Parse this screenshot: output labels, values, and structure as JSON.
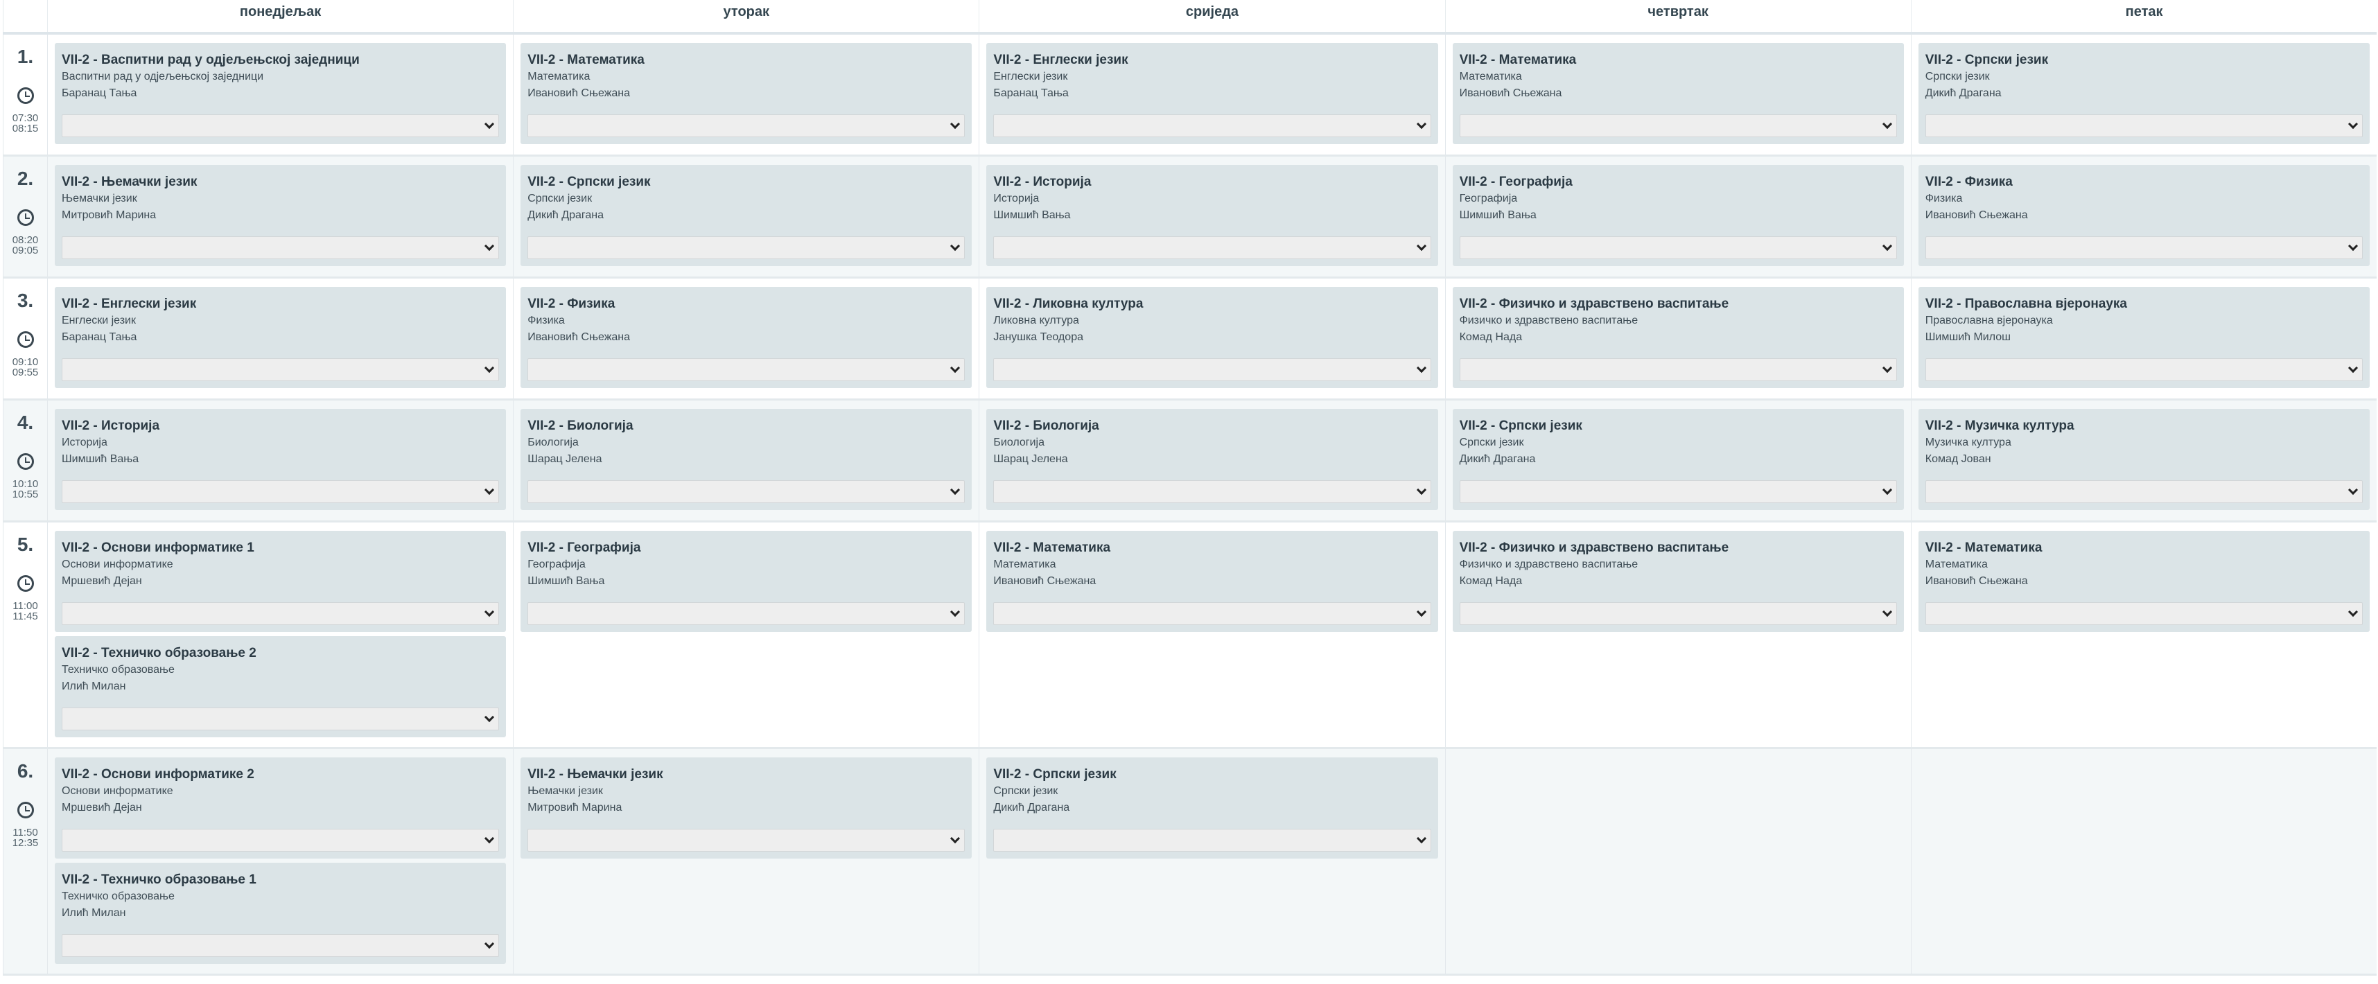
{
  "days": [
    "понедјељак",
    "уторак",
    "сриједа",
    "четвртак",
    "петак"
  ],
  "periods": [
    {
      "no": "1.",
      "start": "07:30",
      "end": "08:15",
      "cells": [
        [
          {
            "title": "VII-2 - Васпитни рад у одјељењској заједници",
            "subject": "Васпитни рад у одјељењској заједници",
            "teacher": "Баранац Тања"
          }
        ],
        [
          {
            "title": "VII-2 - Математика",
            "subject": "Математика",
            "teacher": "Ивановић Сњежана"
          }
        ],
        [
          {
            "title": "VII-2 - Енглески језик",
            "subject": "Енглески језик",
            "teacher": "Баранац Тања"
          }
        ],
        [
          {
            "title": "VII-2 - Математика",
            "subject": "Математика",
            "teacher": "Ивановић Сњежана"
          }
        ],
        [
          {
            "title": "VII-2 - Српски језик",
            "subject": "Српски језик",
            "teacher": "Дикић Драгана"
          }
        ]
      ]
    },
    {
      "no": "2.",
      "start": "08:20",
      "end": "09:05",
      "cells": [
        [
          {
            "title": "VII-2 - Њемачки језик",
            "subject": "Њемачки језик",
            "teacher": "Митровић Марина"
          }
        ],
        [
          {
            "title": "VII-2 - Српски језик",
            "subject": "Српски језик",
            "teacher": "Дикић Драгана"
          }
        ],
        [
          {
            "title": "VII-2 - Историја",
            "subject": "Историја",
            "teacher": "Шимшић Вања"
          }
        ],
        [
          {
            "title": "VII-2 - Географија",
            "subject": "Географија",
            "teacher": "Шимшић Вања"
          }
        ],
        [
          {
            "title": "VII-2 - Физика",
            "subject": "Физика",
            "teacher": "Ивановић Сњежана"
          }
        ]
      ]
    },
    {
      "no": "3.",
      "start": "09:10",
      "end": "09:55",
      "cells": [
        [
          {
            "title": "VII-2 - Енглески језик",
            "subject": "Енглески језик",
            "teacher": "Баранац Тања"
          }
        ],
        [
          {
            "title": "VII-2 - Физика",
            "subject": "Физика",
            "teacher": "Ивановић Сњежана"
          }
        ],
        [
          {
            "title": "VII-2 - Ликовна култура",
            "subject": "Ликовна култура",
            "teacher": "Јанушка Теодора"
          }
        ],
        [
          {
            "title": "VII-2 - Физичко и здравствено васпитање",
            "subject": "Физичко и здравствено васпитање",
            "teacher": "Комад Нада"
          }
        ],
        [
          {
            "title": "VII-2 - Православна вјеронаука",
            "subject": "Православна вјеронаука",
            "teacher": "Шимшић Милош"
          }
        ]
      ]
    },
    {
      "no": "4.",
      "start": "10:10",
      "end": "10:55",
      "cells": [
        [
          {
            "title": "VII-2 - Историја",
            "subject": "Историја",
            "teacher": "Шимшић Вања"
          }
        ],
        [
          {
            "title": "VII-2 - Биологија",
            "subject": "Биологија",
            "teacher": "Шарац Јелена"
          }
        ],
        [
          {
            "title": "VII-2 - Биологија",
            "subject": "Биологија",
            "teacher": "Шарац Јелена"
          }
        ],
        [
          {
            "title": "VII-2 - Српски језик",
            "subject": "Српски језик",
            "teacher": "Дикић Драгана"
          }
        ],
        [
          {
            "title": "VII-2 - Музичка култура",
            "subject": "Музичка култура",
            "teacher": "Комад Јован"
          }
        ]
      ]
    },
    {
      "no": "5.",
      "start": "11:00",
      "end": "11:45",
      "cells": [
        [
          {
            "title": "VII-2 - Основи информатике 1",
            "subject": "Основи информатике",
            "teacher": "Мршевић Дејан"
          },
          {
            "title": "VII-2 - Техничко образовање 2",
            "subject": "Техничко образовање",
            "teacher": "Илић Милан"
          }
        ],
        [
          {
            "title": "VII-2 - Географија",
            "subject": "Географија",
            "teacher": "Шимшић Вања"
          }
        ],
        [
          {
            "title": "VII-2 - Математика",
            "subject": "Математика",
            "teacher": "Ивановић Сњежана"
          }
        ],
        [
          {
            "title": "VII-2 - Физичко и здравствено васпитање",
            "subject": "Физичко и здравствено васпитање",
            "teacher": "Комад Нада"
          }
        ],
        [
          {
            "title": "VII-2 - Математика",
            "subject": "Математика",
            "teacher": "Ивановић Сњежана"
          }
        ]
      ]
    },
    {
      "no": "6.",
      "start": "11:50",
      "end": "12:35",
      "cells": [
        [
          {
            "title": "VII-2 - Основи информатике 2",
            "subject": "Основи информатике",
            "teacher": "Мршевић Дејан"
          },
          {
            "title": "VII-2 - Техничко образовање 1",
            "subject": "Техничко образовање",
            "teacher": "Илић Милан"
          }
        ],
        [
          {
            "title": "VII-2 - Њемачки језик",
            "subject": "Њемачки језик",
            "teacher": "Митровић Марина"
          }
        ],
        [
          {
            "title": "VII-2 - Српски језик",
            "subject": "Српски језик",
            "teacher": "Дикић Драгана"
          }
        ],
        [],
        []
      ]
    }
  ]
}
